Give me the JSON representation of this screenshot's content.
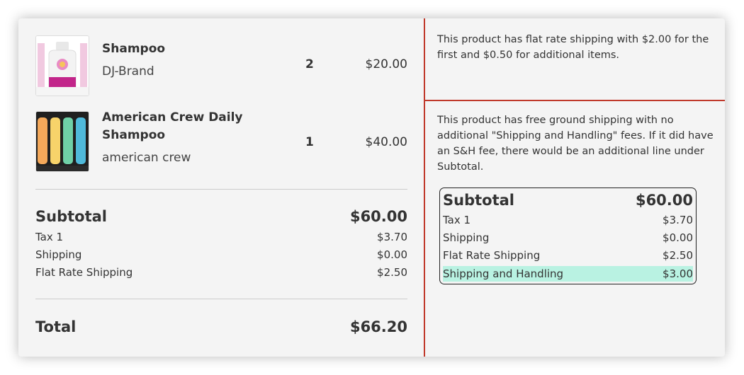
{
  "items": [
    {
      "name": "Shampoo",
      "brand": "DJ-Brand",
      "qty": "2",
      "price": "$20.00"
    },
    {
      "name_line1": "American Crew Daily",
      "name_line2": "Shampoo",
      "brand": "american crew",
      "qty": "1",
      "price": "$40.00"
    }
  ],
  "summary": {
    "subtotal_label": "Subtotal",
    "subtotal": "$60.00",
    "tax_label": "Tax 1",
    "tax": "$3.70",
    "shipping_label": "Shipping",
    "shipping": "$0.00",
    "flat_label": "Flat Rate Shipping",
    "flat": "$2.50",
    "total_label": "Total",
    "total": "$66.20"
  },
  "notes": {
    "note1": "This product has flat rate shipping with $2.00 for the first and $0.50 for additional items.",
    "note2": "This product has free ground shipping with no additional \"Shipping and Handling\" fees. If it did have an S&H fee, there would be an additional line under Subtotal."
  },
  "example_box": {
    "subtotal_label": "Subtotal",
    "subtotal": "$60.00",
    "tax_label": "Tax 1",
    "tax": "$3.70",
    "shipping_label": "Shipping",
    "shipping": "$0.00",
    "flat_label": "Flat Rate Shipping",
    "flat": "$2.50",
    "sh_label": "Shipping and Handling",
    "sh": "$3.00"
  },
  "colors": {
    "divider": "#c0392b",
    "highlight": "#b9f2e2"
  }
}
